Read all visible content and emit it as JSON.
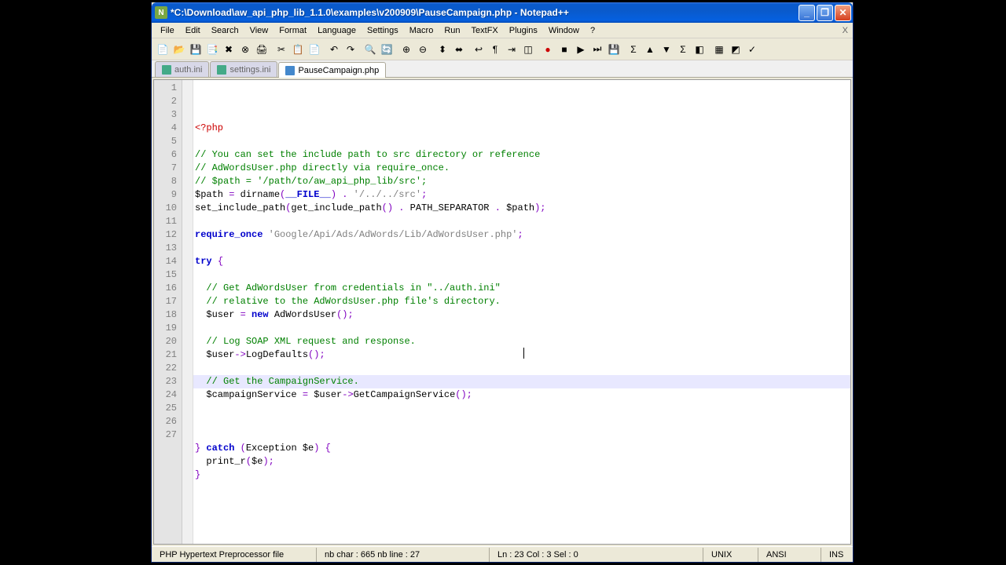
{
  "title": "*C:\\Download\\aw_api_php_lib_1.1.0\\examples\\v200909\\PauseCampaign.php - Notepad++",
  "menus": [
    "File",
    "Edit",
    "Search",
    "View",
    "Format",
    "Language",
    "Settings",
    "Macro",
    "Run",
    "TextFX",
    "Plugins",
    "Window",
    "?"
  ],
  "tabs": [
    {
      "label": "auth.ini",
      "active": false
    },
    {
      "label": "settings.ini",
      "active": false
    },
    {
      "label": "PauseCampaign.php",
      "active": true
    }
  ],
  "status": {
    "filetype": "PHP Hypertext Preprocessor file",
    "chars": "nb char : 665    nb line : 27",
    "pos": "Ln : 23    Col : 3    Sel : 0",
    "eol": "UNIX",
    "enc": "ANSI",
    "mode": "INS"
  },
  "cursor_line": 23,
  "line_count": 27
}
